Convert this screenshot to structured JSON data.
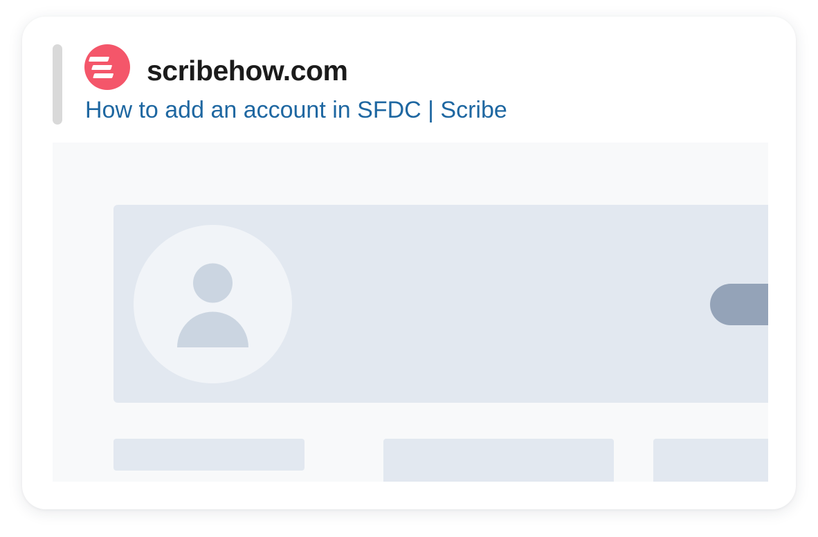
{
  "link_preview": {
    "site_name": "scribehow.com",
    "page_title": "How to add an account in SFDC | Scribe",
    "logo_icon": "scribe-logo-icon",
    "logo_color": "#f4566a",
    "title_color": "#1e67a1"
  },
  "thumbnail": {
    "avatar_icon": "user-avatar-icon",
    "placeholder_color": "#e2e8f0",
    "button_color": "#94a3b8"
  }
}
